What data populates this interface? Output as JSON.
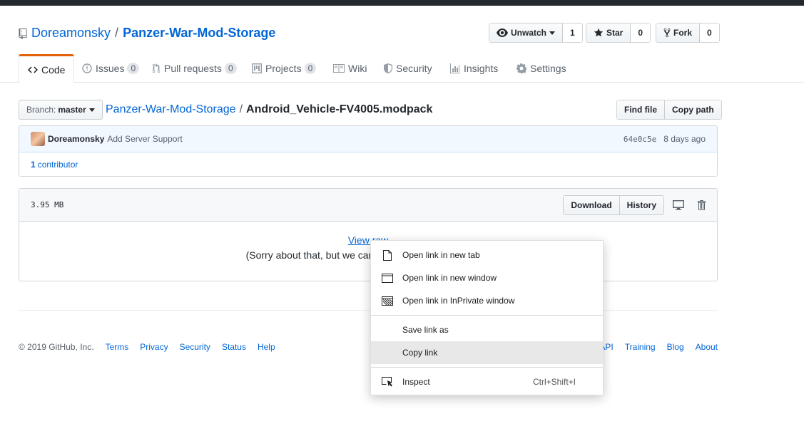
{
  "repo": {
    "owner": "Doreamonsky",
    "separator": "/",
    "name": "Panzer-War-Mod-Storage"
  },
  "actions": {
    "watch_label": "Unwatch",
    "watch_count": "1",
    "star_label": "Star",
    "star_count": "0",
    "fork_label": "Fork",
    "fork_count": "0"
  },
  "tabs": [
    {
      "label": "Code",
      "icon": "code-icon"
    },
    {
      "label": "Issues",
      "count": "0",
      "icon": "issue-icon"
    },
    {
      "label": "Pull requests",
      "count": "0",
      "icon": "pull-request-icon"
    },
    {
      "label": "Projects",
      "count": "0",
      "icon": "project-icon"
    },
    {
      "label": "Wiki",
      "icon": "book-icon"
    },
    {
      "label": "Security",
      "icon": "shield-icon"
    },
    {
      "label": "Insights",
      "icon": "graph-icon"
    },
    {
      "label": "Settings",
      "icon": "gear-icon"
    }
  ],
  "file_nav": {
    "branch_label": "Branch:",
    "branch_value": "master",
    "breadcrumb_repo": "Panzer-War-Mod-Storage",
    "breadcrumb_sep": "/",
    "breadcrumb_file": "Android_Vehicle-FV4005.modpack",
    "find_file": "Find file",
    "copy_path": "Copy path"
  },
  "commit": {
    "author": "Doreamonsky",
    "message": "Add Server Support",
    "sha": "64e0c5e",
    "age": "8 days ago",
    "contributors_count": "1",
    "contributors_label": "contributor"
  },
  "file": {
    "size": "3.95 MB",
    "download": "Download",
    "history": "History",
    "view_raw": "View raw",
    "sorry_text": "(Sorry about that, but we can't sho"
  },
  "footer": {
    "copyright": "© 2019 GitHub, Inc.",
    "links_left": [
      "Terms",
      "Privacy",
      "Security",
      "Status",
      "Help"
    ],
    "links_right": [
      "API",
      "Training",
      "Blog",
      "About"
    ]
  },
  "context_menu": {
    "items": [
      {
        "label": "Open link in new tab",
        "icon": "page-icon"
      },
      {
        "label": "Open link in new window",
        "icon": "window-icon"
      },
      {
        "label": "Open link in InPrivate window",
        "icon": "inprivate-window-icon"
      },
      {
        "label": "Save link as",
        "icon": ""
      },
      {
        "label": "Copy link",
        "icon": "",
        "highlighted": true
      },
      {
        "label": "Inspect",
        "icon": "inspect-icon",
        "shortcut": "Ctrl+Shift+I"
      }
    ]
  },
  "colors": {
    "link": "#0366d6",
    "tab_accent": "#e36209",
    "topbar": "#24292e"
  }
}
